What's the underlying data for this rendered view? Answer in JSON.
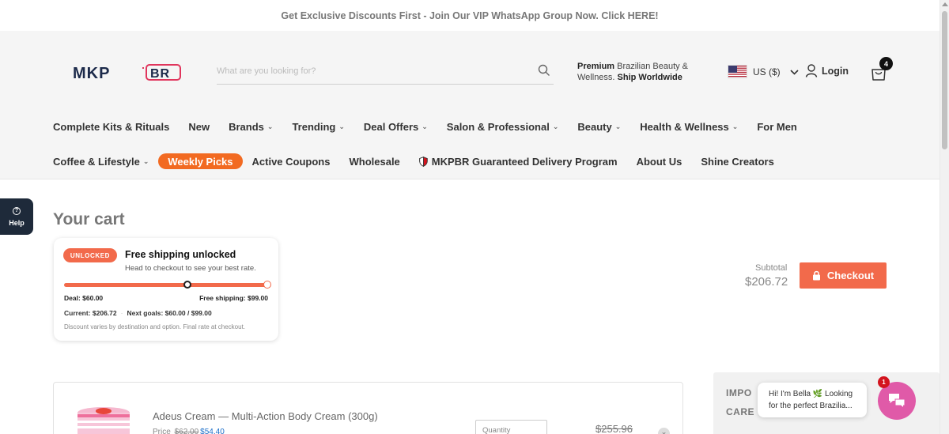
{
  "announcement": "Get Exclusive Discounts First - Join Our VIP WhatsApp Group Now. Click HERE!",
  "header": {
    "logo_text": "MKP",
    "logo_text_box": "BR",
    "search_placeholder": "What are you looking for?",
    "promo_bold_1": "Premium",
    "promo_text": " Brazilian Beauty & Wellness. ",
    "promo_bold_2": "Ship Worldwide",
    "currency": "US ($)",
    "login": "Login",
    "cart_count": "4"
  },
  "nav": {
    "row1": [
      {
        "label": "Complete Kits & Rituals",
        "dropdown": false
      },
      {
        "label": "New",
        "dropdown": false
      },
      {
        "label": "Brands",
        "dropdown": true
      },
      {
        "label": "Trending",
        "dropdown": true
      },
      {
        "label": "Deal Offers",
        "dropdown": true
      },
      {
        "label": "Salon & Professional",
        "dropdown": true
      },
      {
        "label": "Beauty",
        "dropdown": true
      },
      {
        "label": "Health & Wellness",
        "dropdown": true
      },
      {
        "label": "For Men",
        "dropdown": false
      }
    ],
    "row2": {
      "coffee": "Coffee & Lifestyle",
      "weekly": "Weekly Picks",
      "coupons": "Active Coupons",
      "wholesale": "Wholesale",
      "delivery": "MKPBR Guaranteed Delivery Program",
      "about": "About Us",
      "shine": "Shine Creators"
    }
  },
  "help": {
    "icon": "?",
    "label": "Help"
  },
  "cart": {
    "title": "Your cart",
    "shipping": {
      "badge": "UNLOCKED",
      "heading": "Free shipping unlocked",
      "subheading": "Head to checkout to see your best rate.",
      "progress": 1.0,
      "deal_label": "Deal: $60.00",
      "free_label": "Free shipping: $99.00",
      "current": "Current: $206.72",
      "next_goals": "Next goals: $60.00 / $99.00",
      "note": "Discount varies by destination and option. Final rate at checkout."
    },
    "subtotal_label": "Subtotal",
    "subtotal_value": "$206.72",
    "checkout_label": "Checkout",
    "items": [
      {
        "name": "Adeus Cream — Multi-Action Body Cream (300g)",
        "price_label": "Price",
        "price_old": "$62.00",
        "price_new": "$54.40",
        "qty_label": "Quantity",
        "line_total": "$255.96",
        "remove": "×"
      }
    ]
  },
  "side_card": {
    "line1": "IMPO",
    "line2": "CARE"
  },
  "chat": {
    "message": "Hi! I'm Bella 🌿 Looking for the perfect Brazilia...",
    "count": "1"
  },
  "colors": {
    "accent": "#f26a4b",
    "nav_pill": "#f26a21",
    "help_bg": "#1e2a3a",
    "chat": "#e05aa8",
    "logo_navy": "#1c2a4a",
    "logo_pink": "#e0355c"
  }
}
